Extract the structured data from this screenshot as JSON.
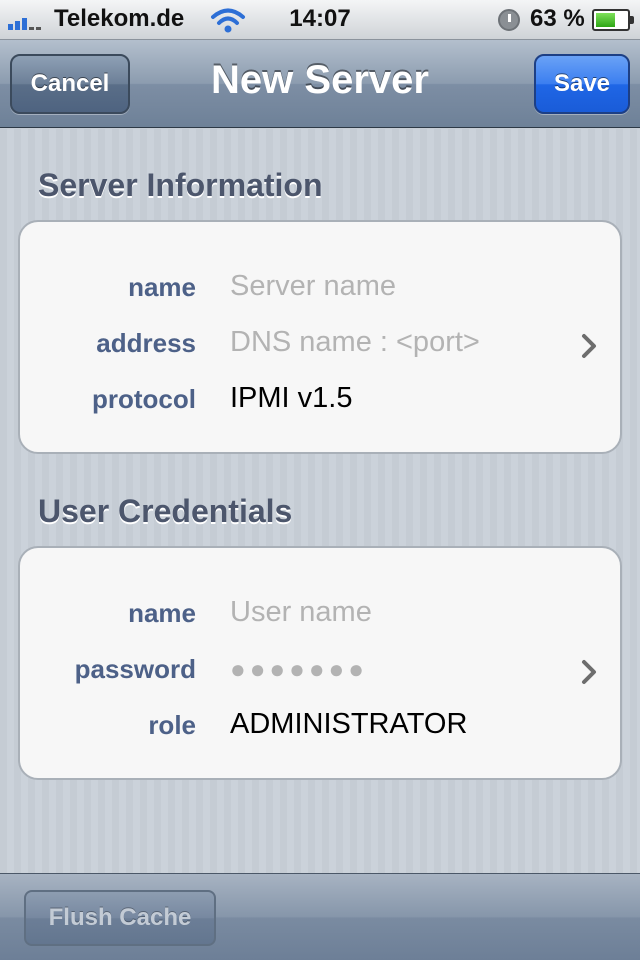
{
  "status_bar": {
    "carrier": "Telekom.de",
    "time": "14:07",
    "battery_percent_text": "63 %",
    "battery_level": 0.63,
    "signal_icon": "signal-bars-icon",
    "wifi_icon": "wifi-icon",
    "alarm_icon": "alarm-clock-icon",
    "battery_icon": "battery-icon"
  },
  "nav_bar": {
    "title": "New Server",
    "cancel_label": "Cancel",
    "save_label": "Save",
    "save_color": "#1f66e6"
  },
  "sections": {
    "server_information": {
      "header": "Server Information",
      "rows": [
        {
          "label": "name",
          "value": "",
          "placeholder": "Server name"
        },
        {
          "label": "address",
          "value": "",
          "placeholder": "DNS name : <port>"
        },
        {
          "label": "protocol",
          "value": "IPMI v1.5"
        }
      ]
    },
    "user_credentials": {
      "header": "User Credentials",
      "rows": [
        {
          "label": "name",
          "value": "",
          "placeholder": "User name"
        },
        {
          "label": "password",
          "value": "●●●●●●●"
        },
        {
          "label": "role",
          "value": "ADMINISTRATOR"
        }
      ]
    }
  },
  "toolbar": {
    "flush_cache_label": "Flush Cache"
  },
  "colors": {
    "label_color": "#4d6188",
    "section_header_color": "#4c566c",
    "placeholder_color": "#b3b3b3"
  }
}
